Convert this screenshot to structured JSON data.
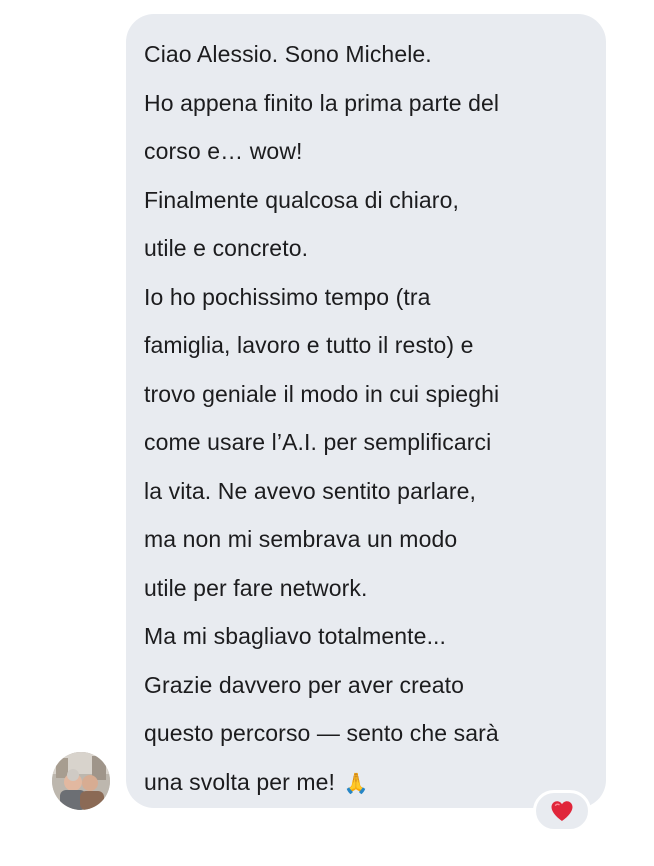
{
  "message": {
    "lines": [
      "Ciao Alessio. Sono Michele.",
      "Ho appena finito la prima parte del",
      "corso e… wow!",
      "Finalmente qualcosa di chiaro,",
      "utile e concreto.",
      "Io ho pochissimo tempo (tra",
      "famiglia, lavoro e tutto il resto) e",
      "trovo geniale il modo in cui spieghi",
      "come usare l’A.I. per semplificarci",
      "la vita. Ne avevo sentito parlare,",
      "ma non mi sembrava un modo",
      "utile per fare network.",
      "Ma mi sbagliavo totalmente...",
      "Grazie davvero per aver creato",
      "questo percorso — sento che sarà",
      "una svolta per me!"
    ],
    "trailing_emoji": "🙏",
    "bubble_color": "#e8ebf0",
    "text_color": "#1c1c1e"
  },
  "reaction": {
    "icon": "red-heart-icon",
    "color": "#e0263a"
  },
  "sender": {
    "avatar_icon": "profile-photo"
  }
}
